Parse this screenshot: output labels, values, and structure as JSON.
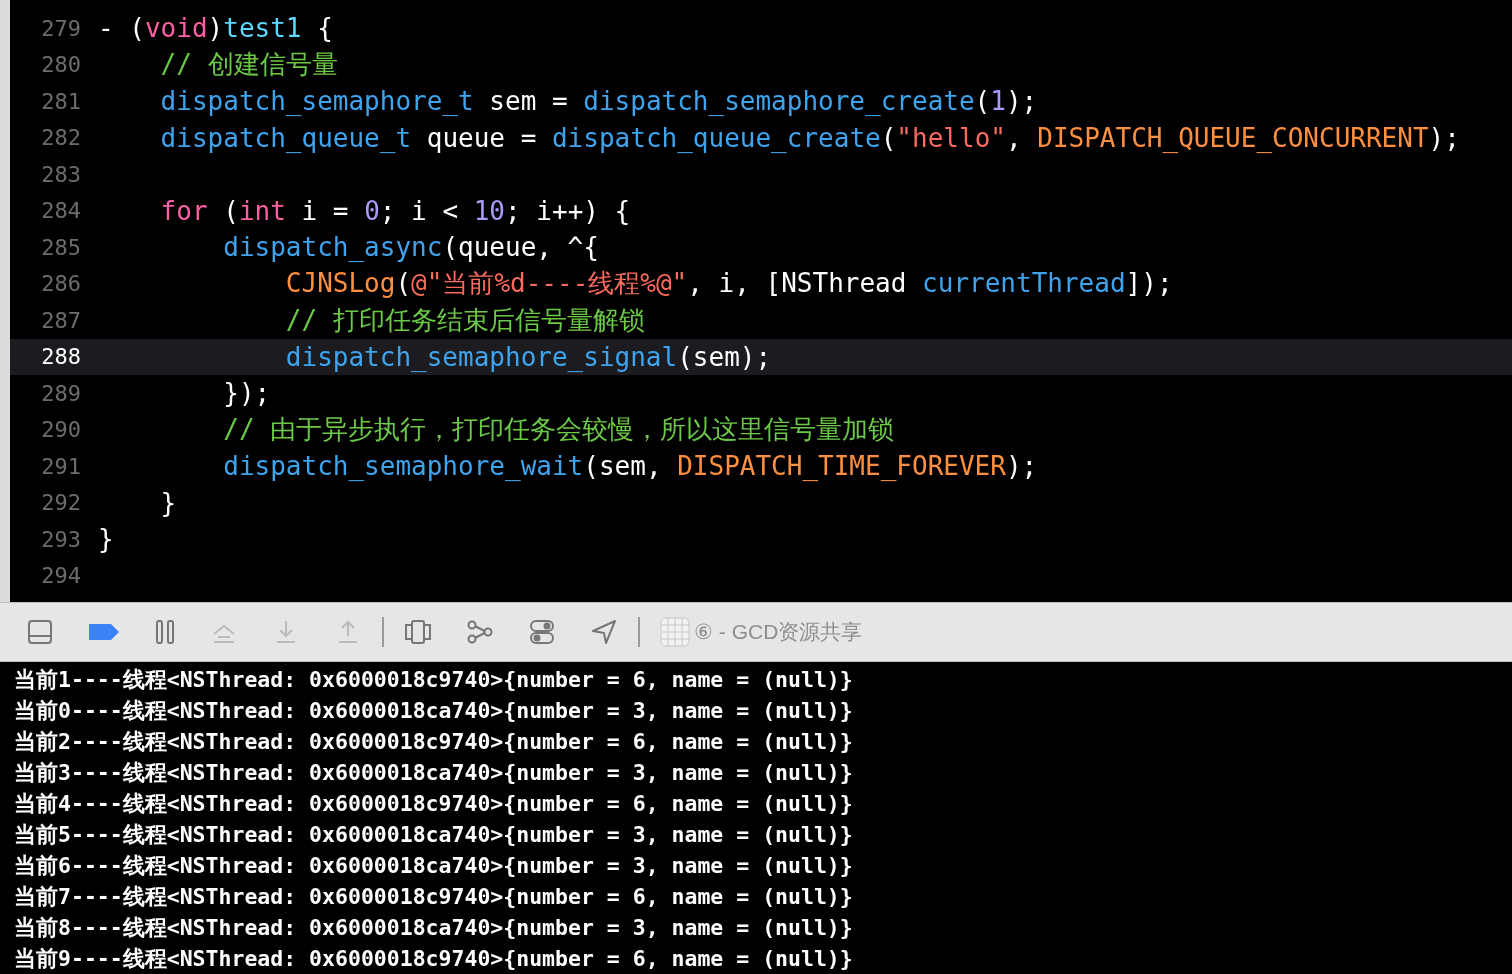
{
  "editor": {
    "lines": [
      {
        "number": "279",
        "current": false,
        "tokens": [
          {
            "text": "- (",
            "kind": "plain"
          },
          {
            "text": "void",
            "kind": "keyword"
          },
          {
            "text": ")",
            "kind": "plain"
          },
          {
            "text": "test1",
            "kind": "decl"
          },
          {
            "text": " {",
            "kind": "plain"
          }
        ]
      },
      {
        "number": "280",
        "current": false,
        "tokens": [
          {
            "text": "    // 创建信号量",
            "kind": "comment"
          }
        ]
      },
      {
        "number": "281",
        "current": false,
        "tokens": [
          {
            "text": "    dispatch_semaphore_t",
            "kind": "func"
          },
          {
            "text": " sem = ",
            "kind": "plain"
          },
          {
            "text": "dispatch_semaphore_create",
            "kind": "func"
          },
          {
            "text": "(",
            "kind": "plain"
          },
          {
            "text": "1",
            "kind": "number"
          },
          {
            "text": ");",
            "kind": "plain"
          }
        ]
      },
      {
        "number": "282",
        "current": false,
        "tokens": [
          {
            "text": "    dispatch_queue_t",
            "kind": "func"
          },
          {
            "text": " queue = ",
            "kind": "plain"
          },
          {
            "text": "dispatch_queue_create",
            "kind": "func"
          },
          {
            "text": "(",
            "kind": "plain"
          },
          {
            "text": "\"hello\"",
            "kind": "string"
          },
          {
            "text": ", ",
            "kind": "plain"
          },
          {
            "text": "DISPATCH_QUEUE_CONCURRENT",
            "kind": "macro"
          },
          {
            "text": ");",
            "kind": "plain"
          }
        ]
      },
      {
        "number": "283",
        "current": false
      },
      {
        "number": "284",
        "current": false,
        "tokens": [
          {
            "text": "    for",
            "kind": "keyword"
          },
          {
            "text": " (",
            "kind": "plain"
          },
          {
            "text": "int",
            "kind": "keyword"
          },
          {
            "text": " i = ",
            "kind": "plain"
          },
          {
            "text": "0",
            "kind": "number"
          },
          {
            "text": "; i < ",
            "kind": "plain"
          },
          {
            "text": "10",
            "kind": "number"
          },
          {
            "text": "; i++) {",
            "kind": "plain"
          }
        ]
      },
      {
        "number": "285",
        "current": false,
        "tokens": [
          {
            "text": "        dispatch_async",
            "kind": "func"
          },
          {
            "text": "(queue, ^{",
            "kind": "plain"
          }
        ]
      },
      {
        "number": "286",
        "current": false,
        "tokens": [
          {
            "text": "            CJNSLog",
            "kind": "macro"
          },
          {
            "text": "(",
            "kind": "plain"
          },
          {
            "text": "@\"当前%d----线程%@\"",
            "kind": "string"
          },
          {
            "text": ", i, [NSThread ",
            "kind": "plain"
          },
          {
            "text": "currentThread",
            "kind": "func"
          },
          {
            "text": "]);",
            "kind": "plain"
          }
        ]
      },
      {
        "number": "287",
        "current": false,
        "tokens": [
          {
            "text": "            // 打印任务结束后信号量解锁",
            "kind": "comment"
          }
        ]
      },
      {
        "number": "288",
        "current": true,
        "tokens": [
          {
            "text": "            dispatch_semaphore_signal",
            "kind": "func"
          },
          {
            "text": "(sem);",
            "kind": "plain"
          }
        ]
      },
      {
        "number": "289",
        "current": false,
        "tokens": [
          {
            "text": "        });",
            "kind": "plain"
          }
        ]
      },
      {
        "number": "290",
        "current": false,
        "tokens": [
          {
            "text": "        // 由于异步执行，打印任务会较慢，所以这里信号量加锁",
            "kind": "comment"
          }
        ]
      },
      {
        "number": "291",
        "current": false,
        "tokens": [
          {
            "text": "        dispatch_semaphore_wait",
            "kind": "func"
          },
          {
            "text": "(sem, ",
            "kind": "plain"
          },
          {
            "text": "DISPATCH_TIME_FOREVER",
            "kind": "macro"
          },
          {
            "text": ");",
            "kind": "plain"
          }
        ]
      },
      {
        "number": "292",
        "current": false,
        "tokens": [
          {
            "text": "    }",
            "kind": "plain"
          }
        ]
      },
      {
        "number": "293",
        "current": false,
        "tokens": [
          {
            "text": "}",
            "kind": "plain"
          }
        ]
      },
      {
        "number": "294",
        "current": false
      }
    ]
  },
  "debug_bar": {
    "breakpoints_active": true,
    "step_buttons_disabled": true,
    "target": "⑥ - GCD资源共享"
  },
  "console": {
    "lines": [
      "当前1----线程<NSThread: 0x6000018c9740>{number = 6, name = (null)}",
      "当前0----线程<NSThread: 0x6000018ca740>{number = 3, name = (null)}",
      "当前2----线程<NSThread: 0x6000018c9740>{number = 6, name = (null)}",
      "当前3----线程<NSThread: 0x6000018ca740>{number = 3, name = (null)}",
      "当前4----线程<NSThread: 0x6000018c9740>{number = 6, name = (null)}",
      "当前5----线程<NSThread: 0x6000018ca740>{number = 3, name = (null)}",
      "当前6----线程<NSThread: 0x6000018ca740>{number = 3, name = (null)}",
      "当前7----线程<NSThread: 0x6000018c9740>{number = 6, name = (null)}",
      "当前8----线程<NSThread: 0x6000018ca740>{number = 3, name = (null)}",
      "当前9----线程<NSThread: 0x6000018c9740>{number = 6, name = (null)}"
    ]
  }
}
